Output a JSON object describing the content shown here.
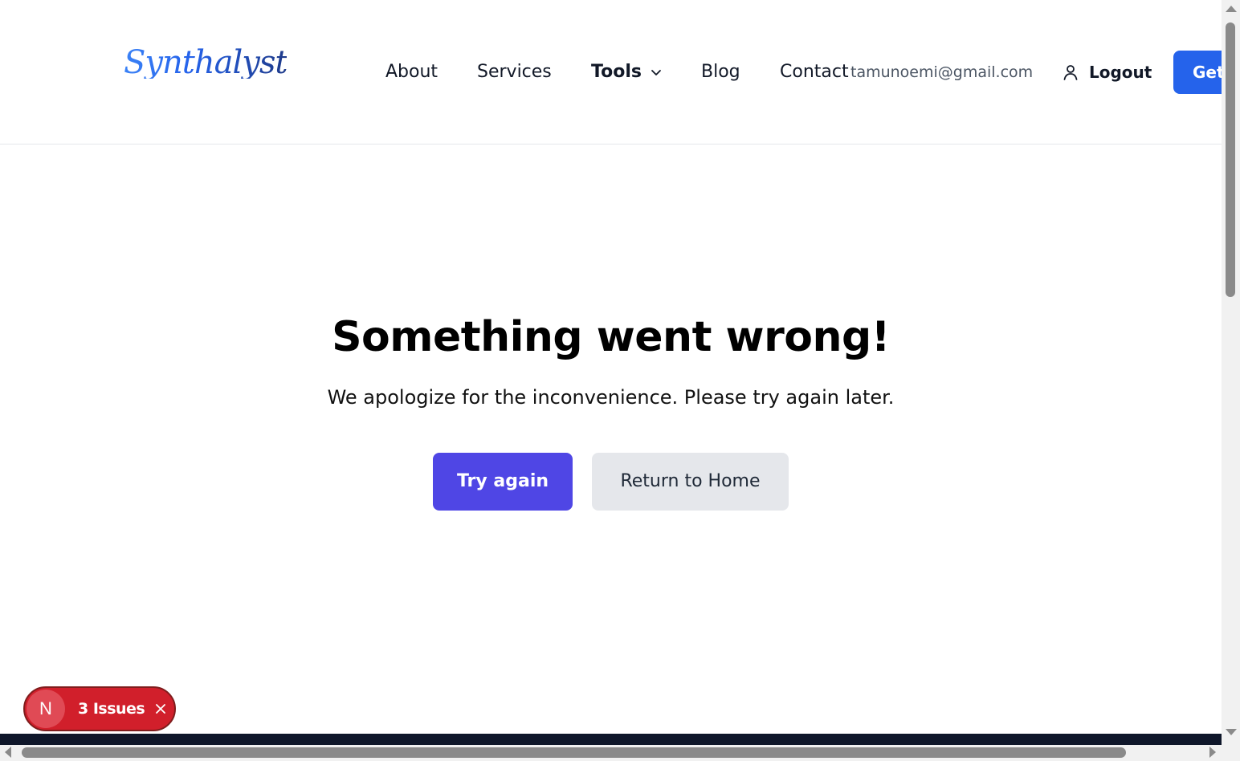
{
  "header": {
    "logo_text": "Synthalyst",
    "nav": {
      "about": "About",
      "services": "Services",
      "tools": "Tools",
      "blog": "Blog",
      "contact": "Contact"
    },
    "user_email": "tamunoemi@gmail.com",
    "logout_label": "Logout",
    "cta_label": "Get"
  },
  "error": {
    "title": "Something went wrong!",
    "message": "We apologize for the inconvenience. Please try again later.",
    "try_again_label": "Try again",
    "return_home_label": "Return to Home"
  },
  "issues_badge": {
    "logo_letter": "N",
    "label": "3 Issues"
  },
  "colors": {
    "primary_button": "#4f46e5",
    "cta_button": "#2563eb",
    "secondary_button": "#e5e7eb",
    "issues_badge": "#d11f2b",
    "footer": "#0f172a"
  },
  "icons": {
    "tools_dropdown": "chevron-down-icon",
    "logout": "user-icon",
    "issues_dismiss": "close-icon"
  }
}
